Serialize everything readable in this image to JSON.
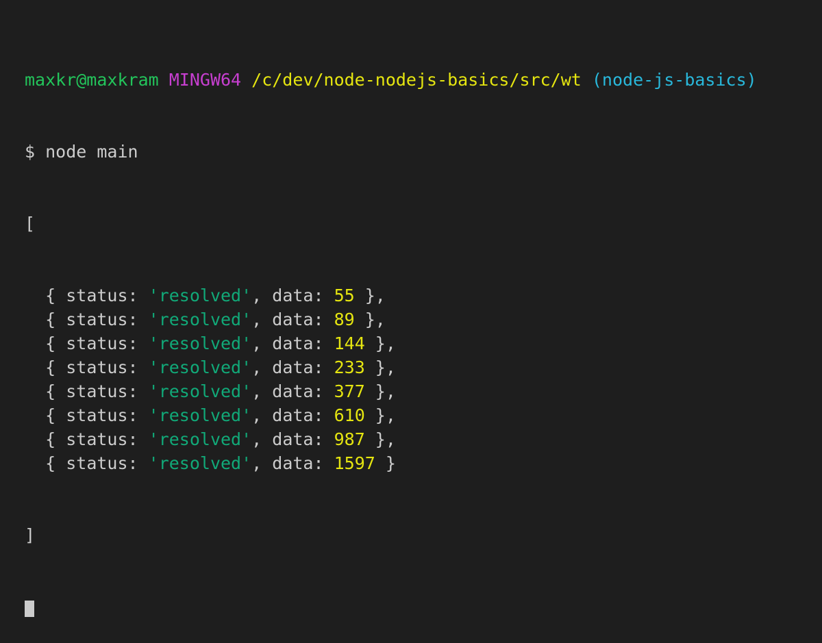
{
  "prompt": {
    "user_host": "maxkr@maxkram",
    "shell": "MINGW64",
    "path": "/c/dev/node-nodejs-basics/src/wt",
    "branch": "(node-js-basics)",
    "symbol": "$",
    "command": "node main"
  },
  "output": {
    "open_bracket": "[",
    "close_bracket": "]",
    "entries": [
      {
        "status": "'resolved'",
        "data": "55"
      },
      {
        "status": "'resolved'",
        "data": "89"
      },
      {
        "status": "'resolved'",
        "data": "144"
      },
      {
        "status": "'resolved'",
        "data": "233"
      },
      {
        "status": "'resolved'",
        "data": "377"
      },
      {
        "status": "'resolved'",
        "data": "610"
      },
      {
        "status": "'resolved'",
        "data": "987"
      },
      {
        "status": "'resolved'",
        "data": "1597"
      }
    ],
    "status_key": "status:",
    "data_key": "data:"
  },
  "colors": {
    "background": "#1e1e1e",
    "text": "#cccccc",
    "user_host": "#23c45b",
    "shell": "#c73fd0",
    "path": "#e5e510",
    "branch": "#29b8db",
    "string": "#11a978",
    "number": "#e5e510"
  }
}
